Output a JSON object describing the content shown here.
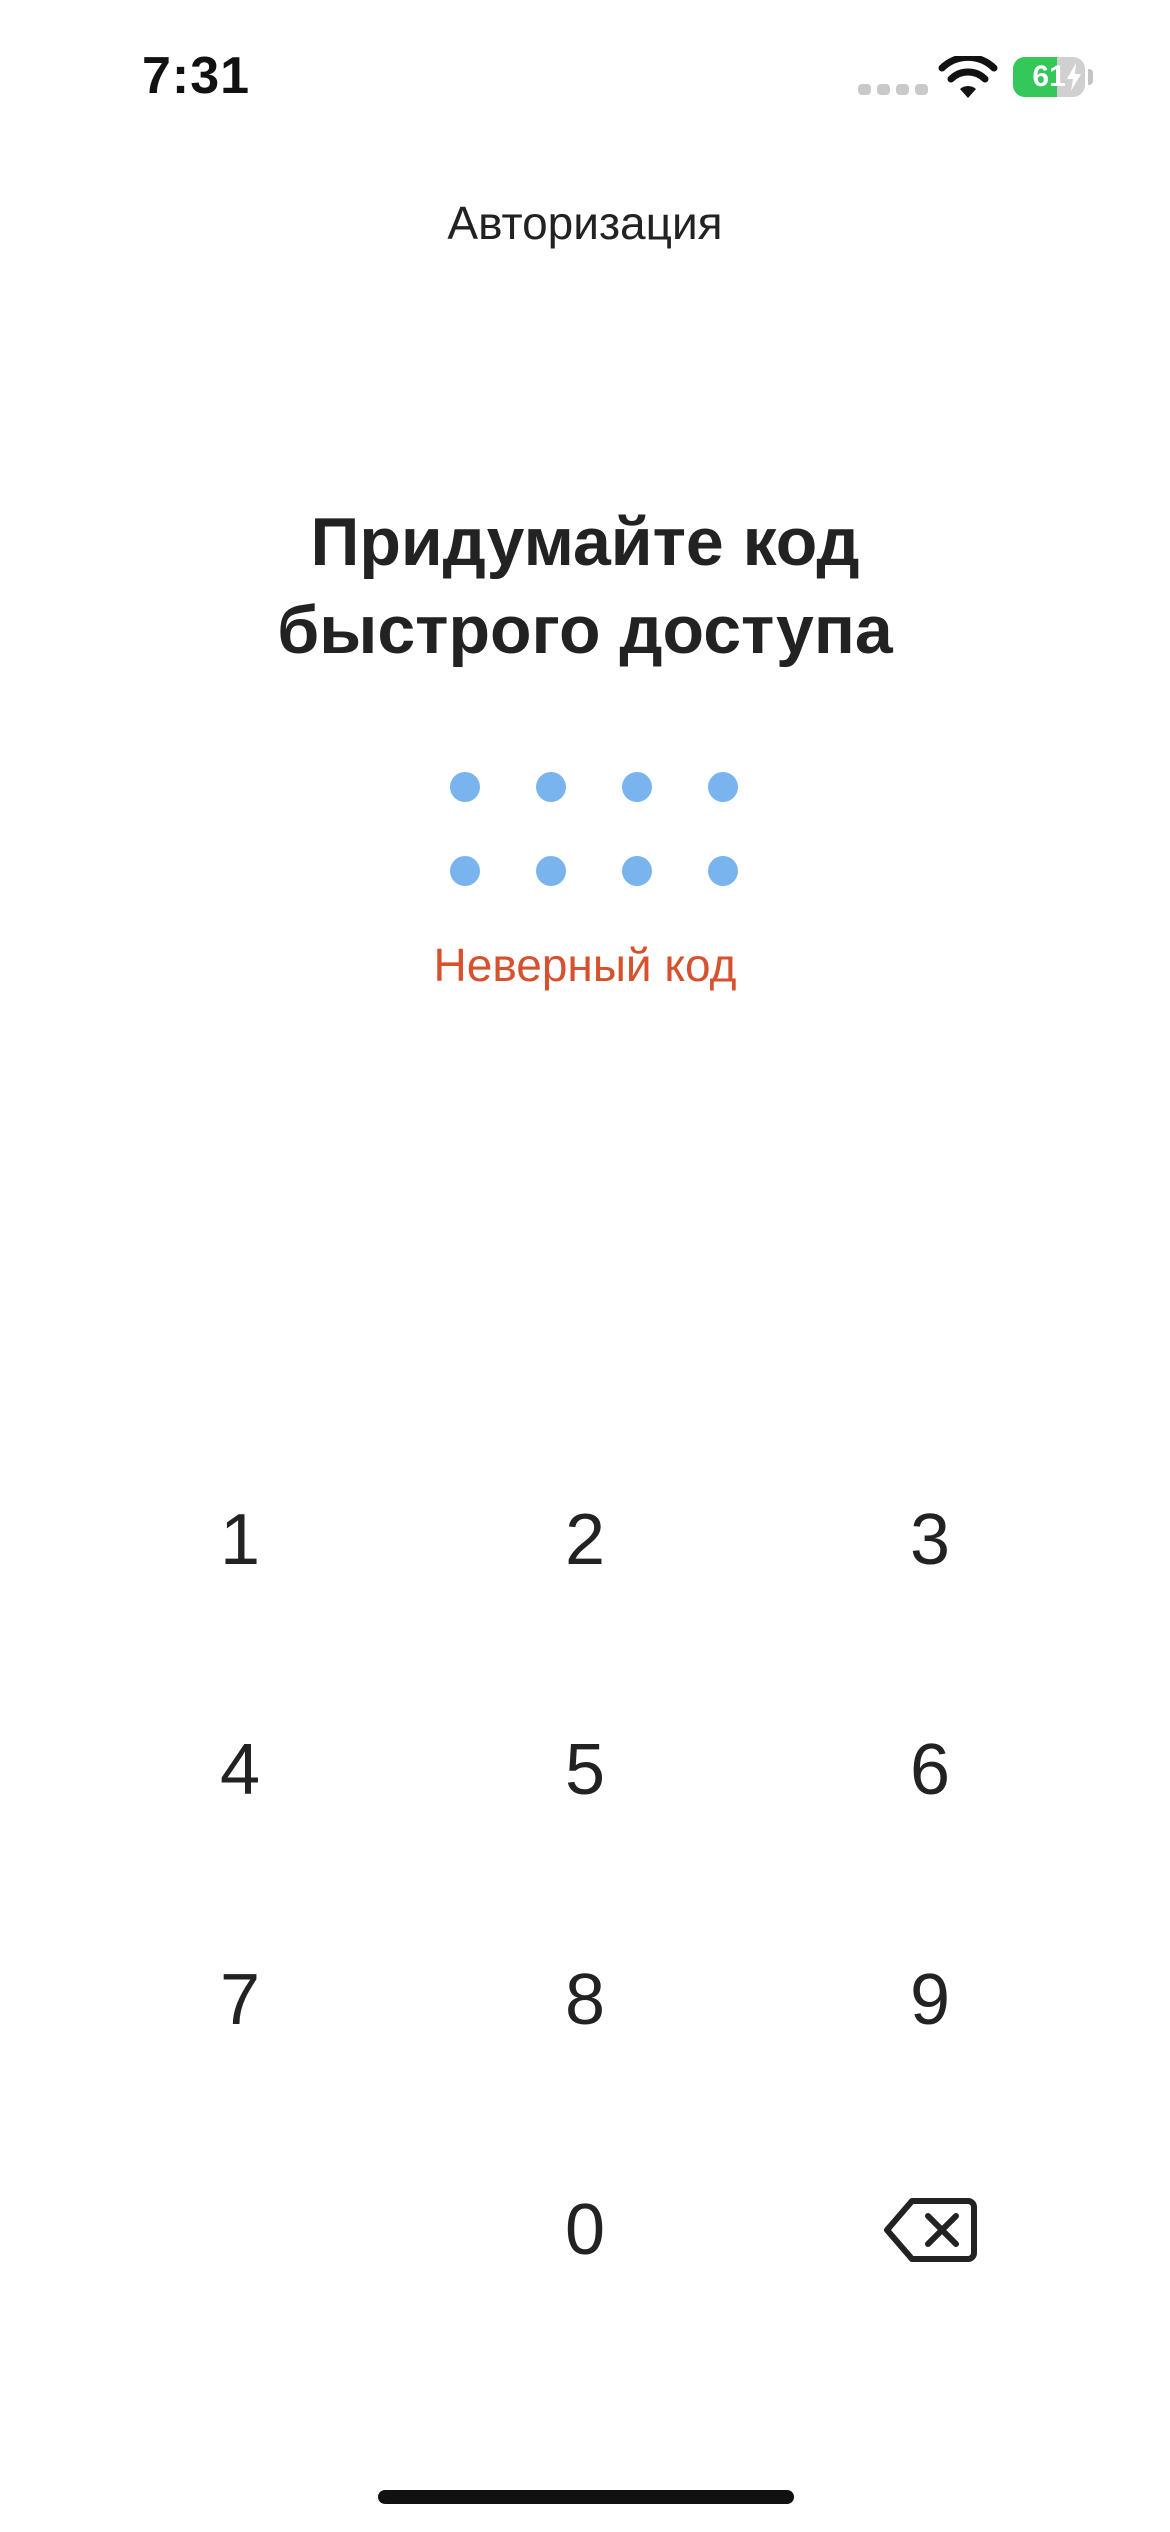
{
  "status_bar": {
    "time": "7:31",
    "battery_level": "61",
    "battery_fraction": 0.61,
    "battery_color": "#34c759",
    "icons": [
      "cellular-signal-icon",
      "wifi-icon",
      "battery-charging-icon"
    ]
  },
  "header": {
    "title": "Авторизация"
  },
  "main": {
    "title_line1": "Придумайте код",
    "title_line2": "быстрого доступа",
    "code_dots": {
      "count": 8,
      "color": "#79b4ee"
    },
    "error_message": "Неверный код",
    "error_color": "#d6522e"
  },
  "keypad": {
    "keys": [
      "1",
      "2",
      "3",
      "4",
      "5",
      "6",
      "7",
      "8",
      "9",
      "0"
    ],
    "backspace_icon": "backspace-icon"
  }
}
